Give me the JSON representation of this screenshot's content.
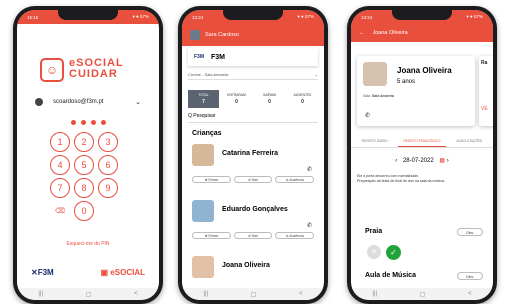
{
  "login": {
    "status_time": "15:15",
    "status_right": "▾ ● 57%",
    "app_logo_icon": "bear-face-icon",
    "app_name_line1": "eSOCIAL",
    "app_name_line2": "CUIDAR",
    "username": "scoardoso@f3m.pt",
    "pin_dots": 4,
    "keys": [
      "1",
      "2",
      "3",
      "4",
      "5",
      "6",
      "7",
      "8",
      "9",
      "",
      "0",
      ""
    ],
    "delete_key": "⌫",
    "forgot": "Esqueci-me do PIN",
    "brand_left": "✕F3M",
    "brand_right": "▣ eSOCIAL"
  },
  "list": {
    "status_time": "13:24",
    "status_right": "▾ ● 57%",
    "user_name": "Sara Cardoso",
    "school_logo": "F3M",
    "school_name": "F3M",
    "room": "Creche - Sala Amarela",
    "room_chevron": "⌄",
    "tabs": [
      {
        "label": "TOTAL",
        "value": "7"
      },
      {
        "label": "ENTRARAM",
        "value": "0"
      },
      {
        "label": "SAÍRAM",
        "value": "0"
      },
      {
        "label": "AUSENTES",
        "value": "0"
      }
    ],
    "search_placeholder": "Q Pesquisar",
    "section_title": "Crianças",
    "children": [
      {
        "name": "Catarina Ferreira",
        "enter": "⊕ Entrar",
        "leave": "⊖ Sair",
        "absent": "⊘ Ausência"
      },
      {
        "name": "Eduardo Gonçalves",
        "enter": "⊕ Entrar",
        "leave": "⊖ Sair",
        "absent": "⊘ Ausência"
      },
      {
        "name": "Joana Oliveira"
      }
    ]
  },
  "detail": {
    "status_time": "13:24",
    "status_right": "▾ ● 57%",
    "title": "Joana Oliveira",
    "child_name": "Joana Oliveira",
    "age": "5 anos",
    "sala_label": "Sala:",
    "sala_value": "Sala Amarela",
    "peek_name": "Ra",
    "peek_link": "VE",
    "tabs": [
      "REGISTO DIÁRIO",
      "REGISTO PEDAGÓGICO",
      "AUSCULTAÇÕES"
    ],
    "date": "28-07-2022",
    "note_line1": "Ele a porta decorreu com normalidade.",
    "note_line2": "Preparação da festa de final de ano na sala da música.",
    "sections": [
      {
        "title": "Praia",
        "obs": "Obs."
      },
      {
        "title": "Aula de Música",
        "obs": "Obs."
      }
    ]
  },
  "nav": {
    "back": "|||",
    "home": "▢",
    "prev": "<"
  },
  "colors": {
    "accent": "#e94f3d",
    "navy": "#1b2a6b",
    "success": "#22a33a"
  }
}
